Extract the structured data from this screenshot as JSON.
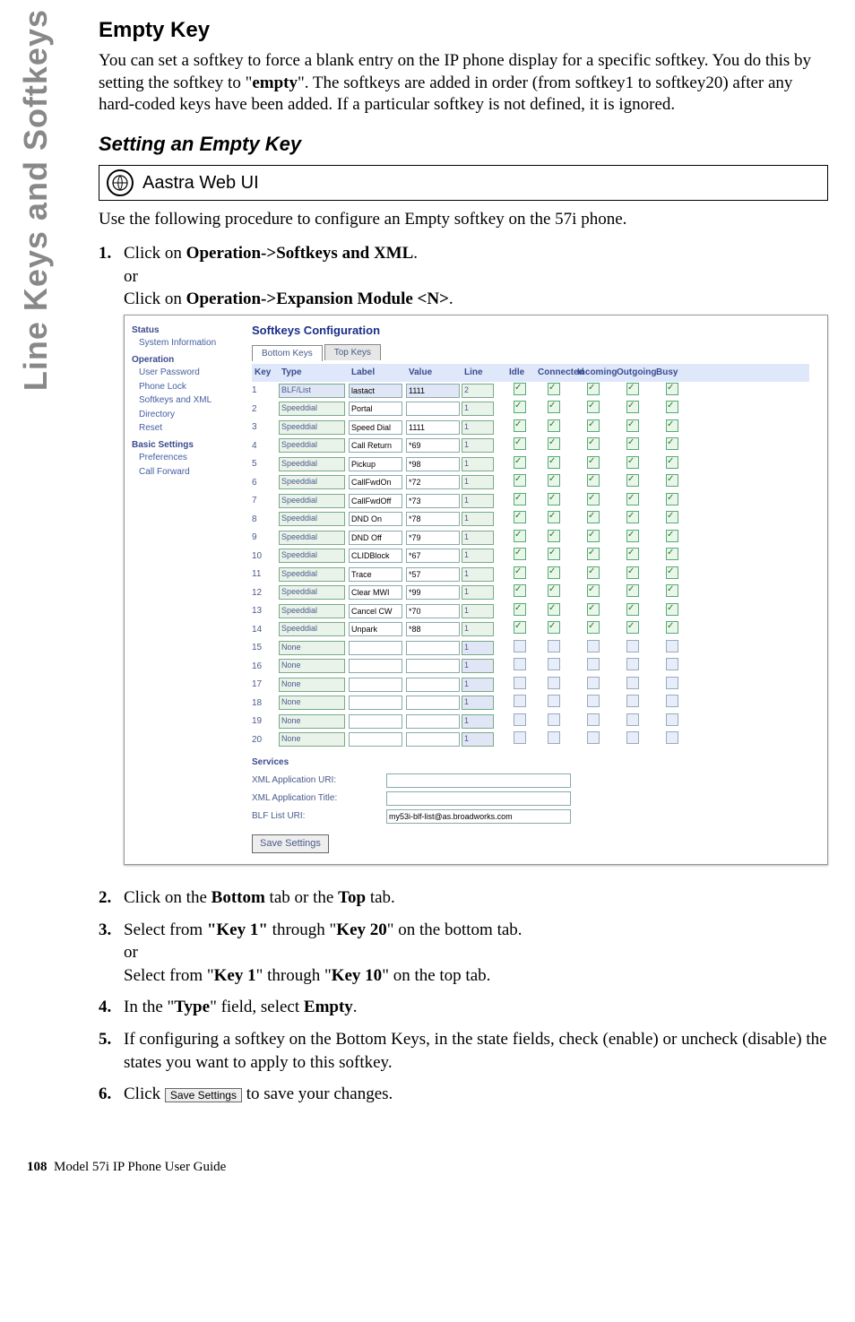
{
  "sidebar_text": "Line Keys and Softkeys",
  "h2": "Empty Key",
  "para1": "You can set a softkey to force a blank entry on the IP phone display for a specific softkey.  You do this by setting the softkey to \"",
  "para1_bold": "empty",
  "para1_tail": "\". The softkeys are added in order (from softkey1 to softkey20) after any hard-coded keys have been added. If a particular softkey is not defined, it is ignored.",
  "section": "Setting an Empty Key",
  "webui": "Aastra Web UI",
  "intro": "Use the following procedure to configure an Empty softkey on the 57i phone.",
  "steps": {
    "s1a": "Click on ",
    "s1b": "Operation->Softkeys and XML",
    "s1c": ".",
    "s1d": "or",
    "s1e": "Click on ",
    "s1f": "Operation->Expansion Module <N>",
    "s1g": ".",
    "s2a": "Click on the ",
    "s2b": "Bottom",
    "s2c": " tab or the ",
    "s2d": "Top",
    "s2e": " tab.",
    "s3a": "Select from ",
    "s3b": "\"Key 1\"",
    "s3c": " through \"",
    "s3d": "Key 20",
    "s3e": "\" on the bottom tab.",
    "s3f": "or",
    "s3g": "Select from \"",
    "s3h": "Key 1",
    "s3i": "\" through \"",
    "s3j": "Key 10",
    "s3k": "\" on the top tab.",
    "s4a": "In the \"",
    "s4b": "Type",
    "s4c": "\" field, select ",
    "s4d": "Empty",
    "s4e": ".",
    "s5": "If configuring a softkey on the Bottom Keys, in the state fields, check (enable) or uncheck (disable) the states you want to apply to this softkey.",
    "s6a": "Click ",
    "s6btn": "Save Settings",
    "s6b": " to save your changes."
  },
  "sc": {
    "nav": {
      "status": "Status",
      "sysinfo": "System Information",
      "operation": "Operation",
      "userpass": "User Password",
      "phonelock": "Phone Lock",
      "softkeys": "Softkeys and XML",
      "directory": "Directory",
      "reset": "Reset",
      "basic": "Basic Settings",
      "prefs": "Preferences",
      "callfwd": "Call Forward"
    },
    "title": "Softkeys Configuration",
    "tab_bottom": "Bottom Keys",
    "tab_top": "Top Keys",
    "headers": [
      "Key",
      "Type",
      "Label",
      "Value",
      "Line",
      "Idle",
      "Connected",
      "Incoming",
      "Outgoing",
      "Busy"
    ],
    "rows": [
      {
        "k": "1",
        "type": "BLF/List",
        "type_dis": true,
        "label": "lastact",
        "label_dis": true,
        "value": "1111",
        "value_dis": true,
        "line": "2",
        "line_dis": false,
        "cb": [
          1,
          1,
          1,
          1,
          1
        ]
      },
      {
        "k": "2",
        "type": "Speeddial",
        "label": "Portal",
        "value": "",
        "line": "1",
        "cb": [
          1,
          1,
          1,
          1,
          1
        ]
      },
      {
        "k": "3",
        "type": "Speeddial",
        "label": "Speed Dial",
        "value": "1111",
        "line": "1",
        "cb": [
          1,
          1,
          1,
          1,
          1
        ]
      },
      {
        "k": "4",
        "type": "Speeddial",
        "label": "Call Return",
        "value": "*69",
        "line": "1",
        "cb": [
          1,
          1,
          1,
          1,
          1
        ]
      },
      {
        "k": "5",
        "type": "Speeddial",
        "label": "Pickup",
        "value": "*98",
        "line": "1",
        "cb": [
          1,
          1,
          1,
          1,
          1
        ]
      },
      {
        "k": "6",
        "type": "Speeddial",
        "label": "CallFwdOn",
        "value": "*72",
        "line": "1",
        "cb": [
          1,
          1,
          1,
          1,
          1
        ]
      },
      {
        "k": "7",
        "type": "Speeddial",
        "label": "CallFwdOff",
        "value": "*73",
        "line": "1",
        "cb": [
          1,
          1,
          1,
          1,
          1
        ]
      },
      {
        "k": "8",
        "type": "Speeddial",
        "label": "DND On",
        "value": "*78",
        "line": "1",
        "cb": [
          1,
          1,
          1,
          1,
          1
        ]
      },
      {
        "k": "9",
        "type": "Speeddial",
        "label": "DND Off",
        "value": "*79",
        "line": "1",
        "cb": [
          1,
          1,
          1,
          1,
          1
        ]
      },
      {
        "k": "10",
        "type": "Speeddial",
        "label": "CLIDBlock",
        "value": "*67",
        "line": "1",
        "cb": [
          1,
          1,
          1,
          1,
          1
        ]
      },
      {
        "k": "11",
        "type": "Speeddial",
        "label": "Trace",
        "value": "*57",
        "line": "1",
        "cb": [
          1,
          1,
          1,
          1,
          1
        ]
      },
      {
        "k": "12",
        "type": "Speeddial",
        "label": "Clear MWI",
        "value": "*99",
        "line": "1",
        "cb": [
          1,
          1,
          1,
          1,
          1
        ]
      },
      {
        "k": "13",
        "type": "Speeddial",
        "label": "Cancel CW",
        "value": "*70",
        "line": "1",
        "cb": [
          1,
          1,
          1,
          1,
          1
        ]
      },
      {
        "k": "14",
        "type": "Speeddial",
        "label": "Unpark",
        "value": "*88",
        "line": "1",
        "cb": [
          1,
          1,
          1,
          1,
          1
        ]
      },
      {
        "k": "15",
        "type": "None",
        "label": "",
        "value": "",
        "line": "1",
        "line_dis": true,
        "cb": [
          0,
          0,
          0,
          0,
          0
        ]
      },
      {
        "k": "16",
        "type": "None",
        "label": "",
        "value": "",
        "line": "1",
        "line_dis": true,
        "cb": [
          0,
          0,
          0,
          0,
          0
        ]
      },
      {
        "k": "17",
        "type": "None",
        "label": "",
        "value": "",
        "line": "1",
        "line_dis": true,
        "cb": [
          0,
          0,
          0,
          0,
          0
        ]
      },
      {
        "k": "18",
        "type": "None",
        "label": "",
        "value": "",
        "line": "1",
        "line_dis": true,
        "cb": [
          0,
          0,
          0,
          0,
          0
        ]
      },
      {
        "k": "19",
        "type": "None",
        "label": "",
        "value": "",
        "line": "1",
        "line_dis": true,
        "cb": [
          0,
          0,
          0,
          0,
          0
        ]
      },
      {
        "k": "20",
        "type": "None",
        "label": "",
        "value": "",
        "line": "1",
        "line_dis": true,
        "cb": [
          0,
          0,
          0,
          0,
          0
        ]
      }
    ],
    "services": "Services",
    "xml_uri": "XML Application URI:",
    "xml_title": "XML Application Title:",
    "blf_uri": "BLF List URI:",
    "blf_val": "my53i-blf-list@as.broadworks.com",
    "save": "Save Settings"
  },
  "footer_page": "108",
  "footer_text": "Model 57i IP Phone User Guide"
}
